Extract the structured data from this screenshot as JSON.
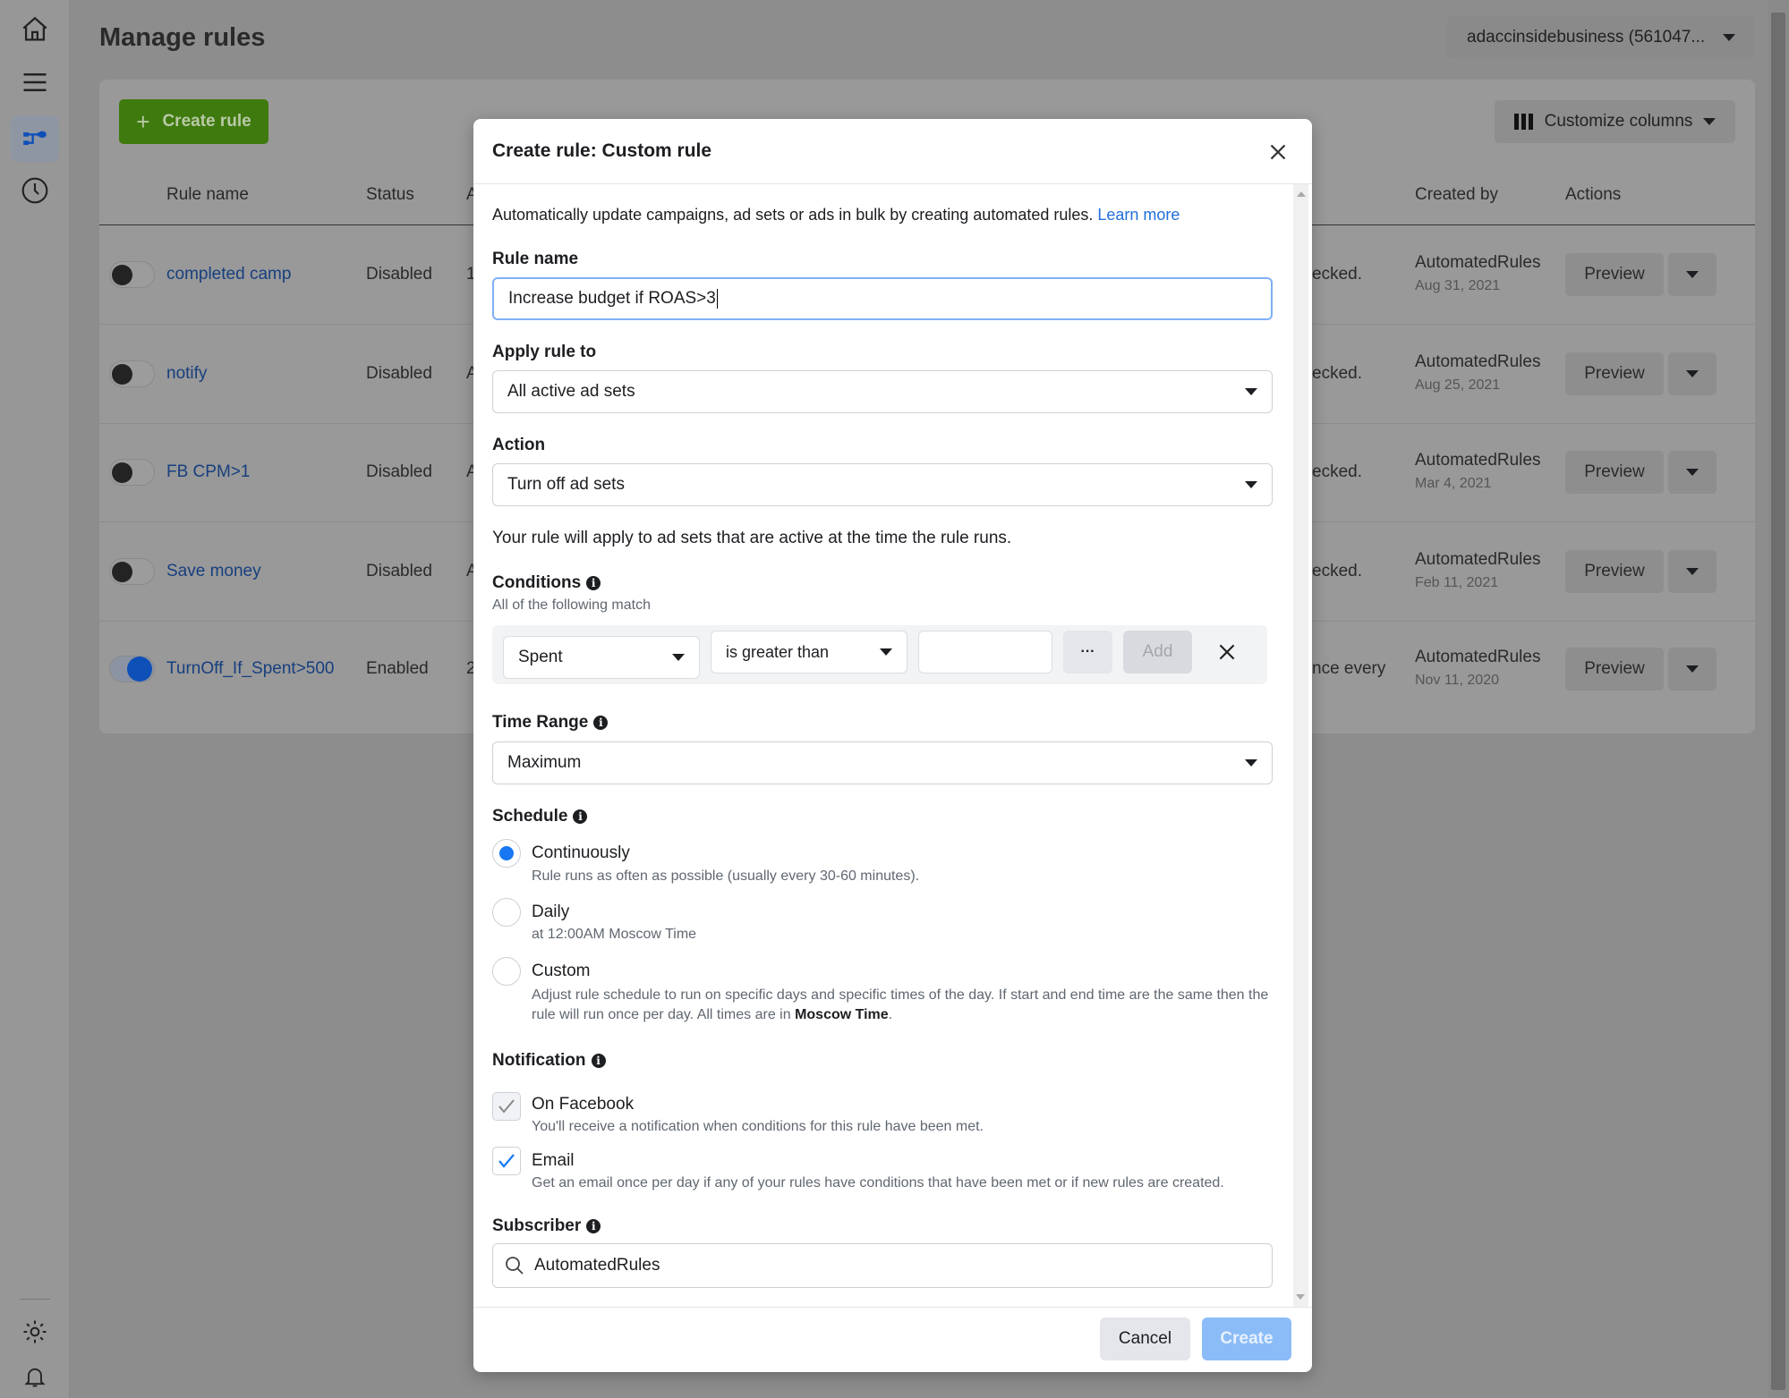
{
  "page": {
    "title": "Manage rules",
    "account": "adaccinsidebusiness (561047...",
    "create_rule": "Create rule",
    "customize_columns": "Customize columns"
  },
  "sidebar": {
    "icons": [
      "home-icon",
      "menu-icon",
      "rules-icon",
      "history-icon",
      "settings-icon",
      "bell-icon"
    ]
  },
  "table": {
    "headers": {
      "rule_name": "Rule name",
      "status": "Status",
      "col3": "A",
      "created_by": "Created by",
      "actions": "Actions"
    },
    "rows": [
      {
        "name": "completed camp",
        "status": "Disabled",
        "col3": "1",
        "desc": "ecked.",
        "created_by": "AutomatedRules",
        "date": "Aug 31, 2021",
        "enabled": false,
        "preview": "Preview"
      },
      {
        "name": "notify",
        "status": "Disabled",
        "col3": "A",
        "desc": "ecked.",
        "created_by": "AutomatedRules",
        "date": "Aug 25, 2021",
        "enabled": false,
        "preview": "Preview"
      },
      {
        "name": "FB CPM>1",
        "status": "Disabled",
        "col3": "A",
        "desc": "ecked.",
        "created_by": "AutomatedRules",
        "date": "Mar 4, 2021",
        "enabled": false,
        "preview": "Preview"
      },
      {
        "name": "Save money",
        "status": "Disabled",
        "col3": "A",
        "desc": "ecked.",
        "created_by": "AutomatedRules",
        "date": "Feb 11, 2021",
        "enabled": false,
        "preview": "Preview"
      },
      {
        "name": "TurnOff_If_Spent>500",
        "status": "Enabled",
        "col3": "2",
        "desc": "nce every",
        "created_by": "AutomatedRules",
        "date": "Nov 11, 2020",
        "enabled": true,
        "preview": "Preview"
      }
    ]
  },
  "modal": {
    "title": "Create rule: Custom rule",
    "description": "Automatically update campaigns, ad sets or ads in bulk by creating automated rules.",
    "learn_more": "Learn more",
    "rule_name_label": "Rule name",
    "rule_name_value": "Increase budget if ROAS>3",
    "apply_label": "Apply rule to",
    "apply_value": "All active ad sets",
    "action_label": "Action",
    "action_value": "Turn off ad sets",
    "apply_note": "Your rule will apply to ad sets that are active at the time the rule runs.",
    "conditions_label": "Conditions",
    "conditions_sub": "All of the following match",
    "condition": {
      "metric": "Spent",
      "operator": "is greater than",
      "value": "",
      "more": "···",
      "add": "Add"
    },
    "time_range_label": "Time Range",
    "time_range_value": "Maximum",
    "schedule_label": "Schedule",
    "schedule": [
      {
        "label": "Continuously",
        "sub": "Rule runs as often as possible (usually every 30-60 minutes).",
        "selected": true
      },
      {
        "label": "Daily",
        "sub": "at 12:00AM Moscow Time",
        "selected": false
      },
      {
        "label": "Custom",
        "sub": "Adjust rule schedule to run on specific days and specific times of the day. If start and end time are the same then the rule will run once per day. All times are in ",
        "sub_bold": "Moscow Time",
        "sub_end": ".",
        "selected": false
      }
    ],
    "notification_label": "Notification",
    "notifications": [
      {
        "label": "On Facebook",
        "sub": "You'll receive a notification when conditions for this rule have been met.",
        "checked": true,
        "disabled": true
      },
      {
        "label": "Email",
        "sub": "Get an email once per day if any of your rules have conditions that have been met or if new rules are created.",
        "checked": true,
        "disabled": false
      }
    ],
    "subscriber_label": "Subscriber",
    "subscriber_value": "AutomatedRules",
    "cancel": "Cancel",
    "create": "Create"
  },
  "colors": {
    "accent": "#1877f2",
    "link": "#216fdb",
    "create_green": "#3f7a0e",
    "create_disabled": "#8bbcf7"
  }
}
